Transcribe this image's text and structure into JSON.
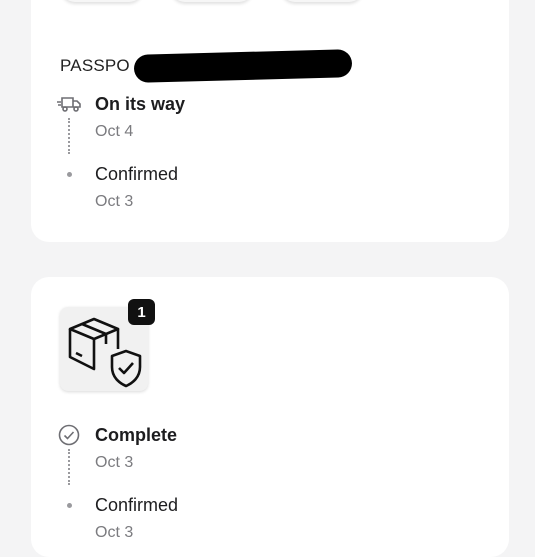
{
  "order1": {
    "reference_prefix": "PASSPO",
    "timeline": [
      {
        "status": "On its way",
        "date": "Oct 4",
        "icon": "truck-icon"
      },
      {
        "status": "Confirmed",
        "date": "Oct 3",
        "icon": "dot-icon"
      }
    ]
  },
  "order2": {
    "item_icon": "package-shield-icon",
    "quantity_badge": "1",
    "timeline": [
      {
        "status": "Complete",
        "date": "Oct 3",
        "icon": "check-circle-icon"
      },
      {
        "status": "Confirmed",
        "date": "Oct 3",
        "icon": "dot-icon"
      }
    ]
  },
  "colors": {
    "background": "#f4f4f5",
    "card": "#ffffff",
    "muted": "#7b7b7f",
    "badge": "#111111"
  }
}
